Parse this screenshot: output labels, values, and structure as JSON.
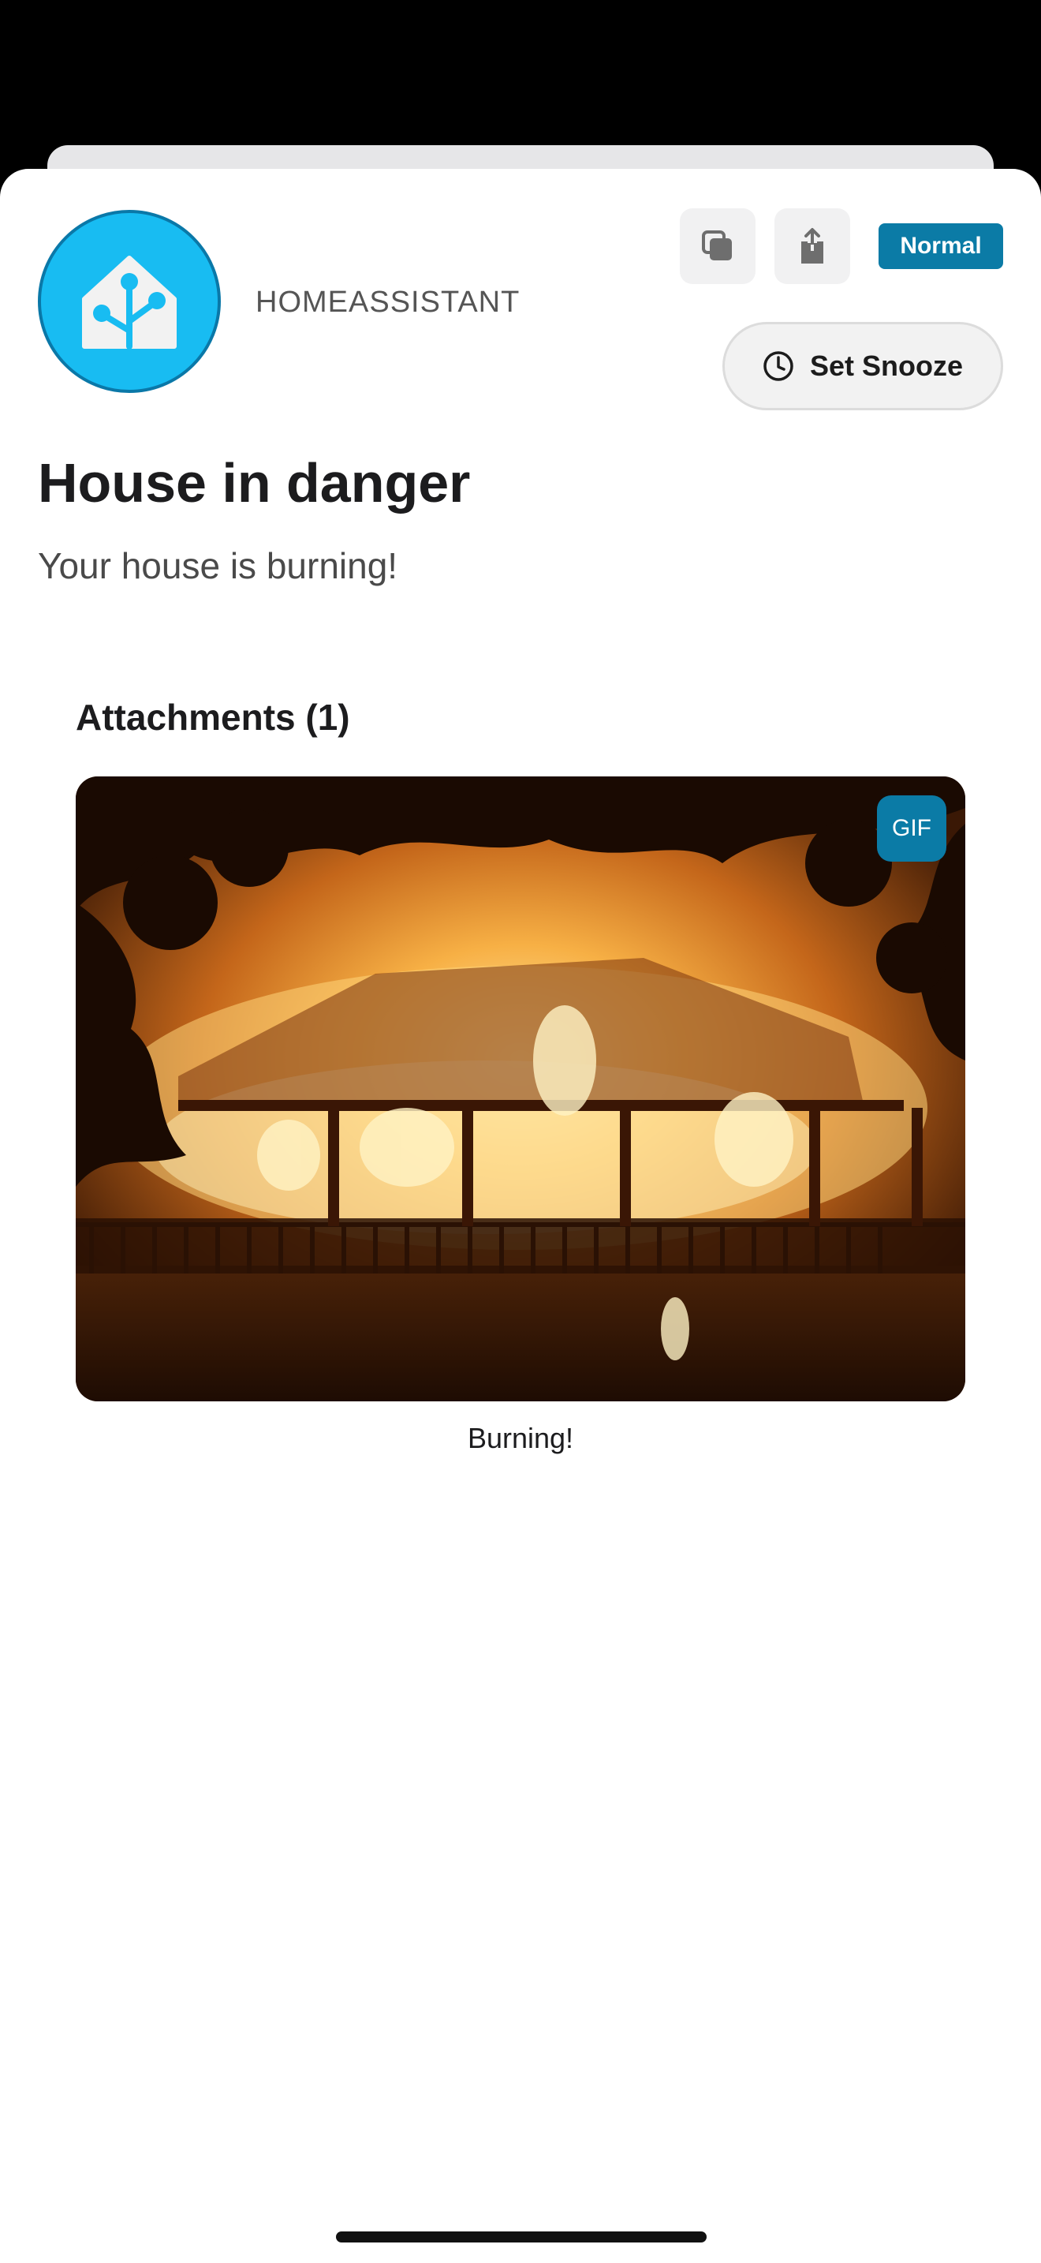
{
  "app": {
    "name": "HOMEASSISTANT",
    "icon": "home-assistant-logo",
    "brand_color": "#18bcf2"
  },
  "toolbar": {
    "copy_icon": "copy-icon",
    "share_icon": "share-icon",
    "priority": "Normal",
    "priority_color": "#0b7ba6",
    "snooze_label": "Set Snooze",
    "snooze_icon": "clock-icon"
  },
  "notification": {
    "title": "House in danger",
    "message": "Your house is burning!"
  },
  "attachments": {
    "header": "Attachments (1)",
    "items": [
      {
        "type_badge": "GIF",
        "caption": "Burning!"
      }
    ]
  }
}
